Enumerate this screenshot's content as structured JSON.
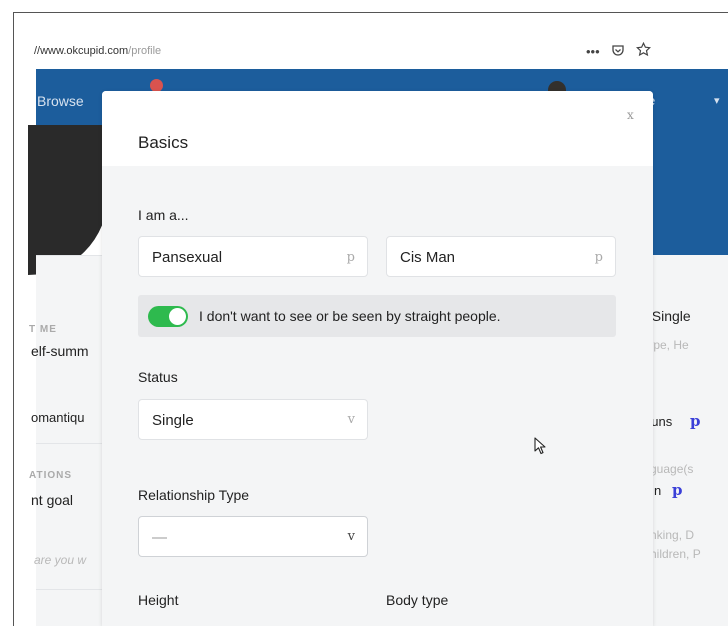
{
  "browser": {
    "url_prefix": "//www.okcupid.com",
    "url_path": "/profile",
    "more_icon": "ellipsis-icon",
    "pocket_icon": "pocket-icon",
    "star_icon": "star-icon"
  },
  "nav": {
    "browse_label": "Browse",
    "right_label": "e"
  },
  "background_profile": {
    "left": {
      "section1_title": "T ME",
      "section1_value": "elf-summ",
      "section2_value": "omantiqu",
      "section3_title": "ATIONS",
      "section3_value": "nt goal",
      "section3_placeholder": "are you w"
    },
    "right": {
      "status_value": ", Single",
      "status_hint": "type, He",
      "pronouns": "ouns",
      "pronouns_icon": "p",
      "language_hint": "guage(s",
      "language_value": "n",
      "language_icon": "p",
      "habits_hint1": "nking, D",
      "habits_hint2": "hildren, P"
    }
  },
  "modal": {
    "title": "Basics",
    "close_label": "x",
    "iam_label": "I am a...",
    "orientation_value": "Pansexual",
    "orientation_icon": "p",
    "gender_value": "Cis Man",
    "gender_icon": "p",
    "toggle_label": "I don't want to see or be seen by straight people.",
    "toggle_on": true,
    "status_label": "Status",
    "status_value": "Single",
    "status_icon": "v",
    "relationship_label": "Relationship Type",
    "relationship_value": "—",
    "relationship_icon": "v",
    "height_label": "Height",
    "bodytype_label": "Body type"
  },
  "colors": {
    "brand_blue": "#1c5d9c",
    "toggle_green": "#2eba4e",
    "link_purple": "#3a3fd8"
  }
}
